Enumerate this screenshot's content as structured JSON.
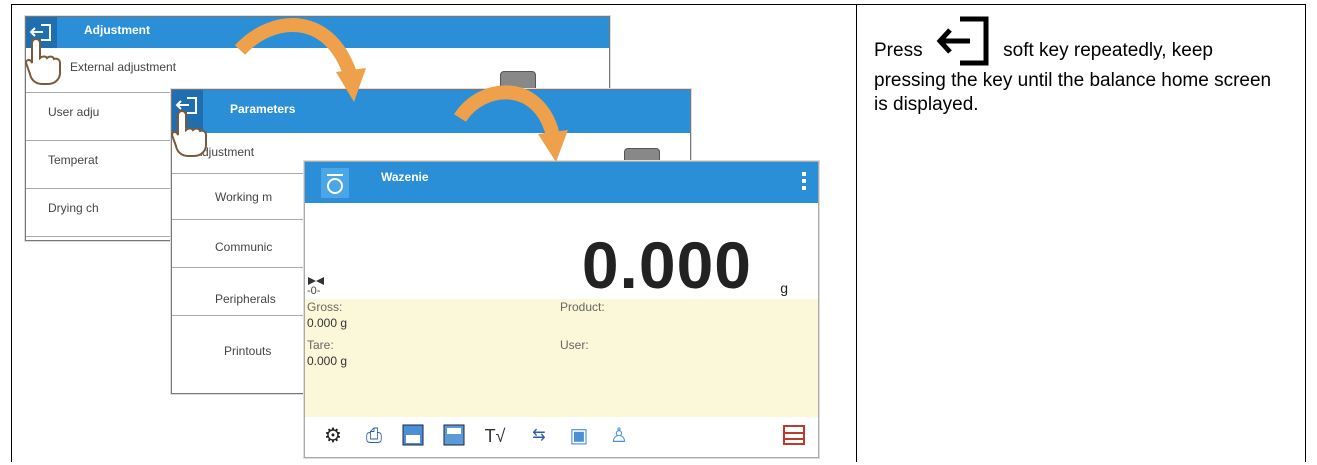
{
  "screens": {
    "adjustment": {
      "title": "Adjustment",
      "items": [
        "External adjustment",
        "User adju",
        "Temperat",
        "Drying ch"
      ]
    },
    "parameters": {
      "title": "Parameters",
      "items": [
        "Adjustment",
        "Working m",
        "Communic",
        "Peripherals",
        "Printouts"
      ]
    },
    "weighing": {
      "title": "Wazenie",
      "value": "0.000",
      "unit": "g",
      "zero_label": "-0-",
      "gross_label": "Gross:",
      "gross_value": "0.000 g",
      "tare_label": "Tare:",
      "tare_value": "0.000 g",
      "product_label": "Product:",
      "user_label": "User:"
    }
  },
  "instruction": {
    "before": "Press",
    "after": "soft key repeatedly, keep pressing the key until the balance home screen is displayed."
  },
  "icons": [
    "back-exit-icon",
    "hand-pointer-icon",
    "curved-arrow-icon",
    "weighing-pan-icon",
    "gear-icon",
    "printer-icon",
    "tare-icon",
    "zero-icon",
    "tare-value-icon",
    "communication-icon",
    "database-icon",
    "user-icon",
    "menu-icon"
  ]
}
